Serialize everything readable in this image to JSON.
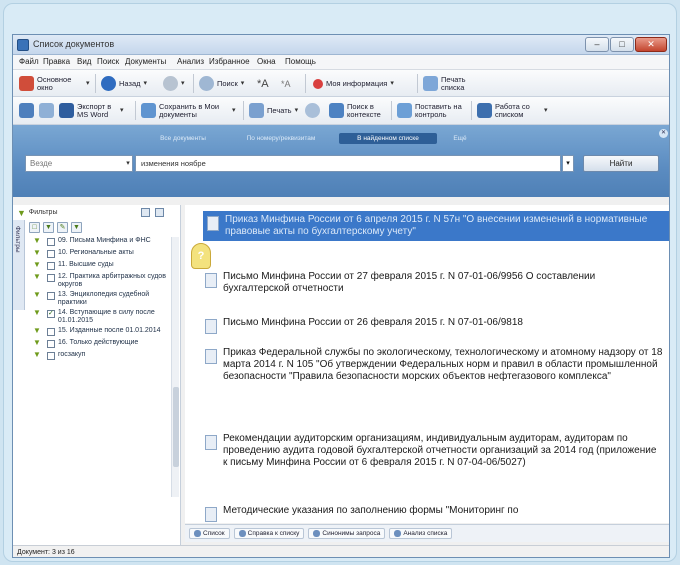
{
  "window": {
    "title": "Список документов"
  },
  "menu": [
    "Файл",
    "Правка",
    "Вид",
    "Поиск",
    "Документы",
    "Анализ",
    "Избранное",
    "Окна",
    "Помощь"
  ],
  "toolbar1": {
    "home": "Основное окно",
    "back": "Назад",
    "search": "Поиск",
    "info": "Моя информация",
    "print_lists": "Печать списка"
  },
  "toolbar2": {
    "export_word": "Экспорт в MS Word",
    "save_doc": "Сохранить в Мои документы",
    "print": "Печать",
    "search_context": "Поиск в контексте",
    "control": "Поставить на контроль",
    "work_list": "Работа со списком"
  },
  "search_tabs": [
    "Все документы",
    "По номеру/реквизитам",
    "В найденном списке",
    "Ещё"
  ],
  "search": {
    "scope": "Везде",
    "query": "изменения ноябре",
    "button": "Найти"
  },
  "filter": {
    "title": "Фильтры",
    "side_tab": "Фильтры",
    "items": [
      {
        "label": "09. Письма Минфина и ФНС",
        "checked": false
      },
      {
        "label": "10. Региональные акты",
        "checked": false
      },
      {
        "label": "11. Высшие суды",
        "checked": false
      },
      {
        "label": "12. Практика арбитражных судов округов",
        "checked": false
      },
      {
        "label": "13. Энциклопедия судебной практики",
        "checked": false
      },
      {
        "label": "14. Вступающие в силу после 01.01.2015",
        "checked": true
      },
      {
        "label": "15. Изданные после 01.01.2014",
        "checked": false
      },
      {
        "label": "16. Только действующие",
        "checked": false
      },
      {
        "label": "госзакуп",
        "checked": false
      }
    ]
  },
  "results": [
    {
      "text": "Приказ Минфина России от 6 апреля 2015 г. N 57н \"О внесении изменений в нормативные правовые акты по бухгалтерскому учету\""
    },
    {
      "text": "Письмо Минфина России от 27 февраля 2015 г. N 07-01-06/9956 О составлении бухгалтерской отчетности"
    },
    {
      "text": "Письмо Минфина России от 26 февраля 2015 г. N 07-01-06/9818"
    },
    {
      "text": "Приказ Федеральной службы по экологическому, технологическому и атомному надзору от 18 марта 2014 г. N 105 \"Об утверждении Федеральных норм и правил в области промышленной безопасности \"Правила безопасности морских объектов нефтегазового комплекса\""
    },
    {
      "text": "Рекомендации аудиторским организациям, индивидуальным аудиторам, аудиторам по проведению аудита годовой бухгалтерской отчетности организаций за 2014 год (приложение к письму Минфина России от 6 февраля 2015 г. N 07-04-06/5027)"
    },
    {
      "text": "Методические указания по заполнению формы \"Мониторинг по"
    }
  ],
  "bottom_tabs": [
    "Список",
    "Справка к списку",
    "Синонимы запроса",
    "Анализ списка"
  ],
  "status": "Документ: 3 из 16",
  "colors": {
    "accent": "#3b78c9",
    "panel": "#5b8cc1",
    "filter_icon": "#6f9b1c"
  }
}
